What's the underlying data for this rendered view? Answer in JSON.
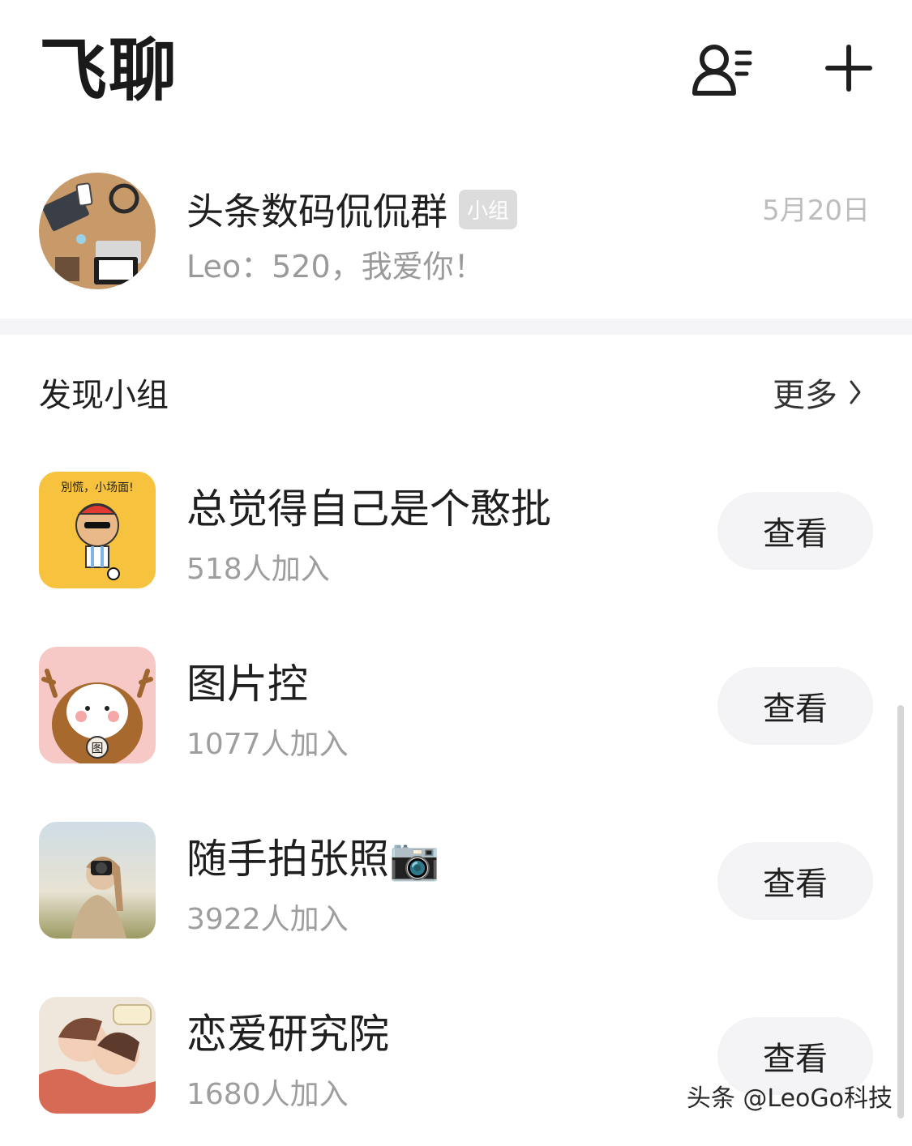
{
  "header": {
    "title": "飞聊"
  },
  "chat": {
    "name": "头条数码侃侃群",
    "tag": "小组",
    "date": "5月20日",
    "preview": "Leo：520，我爱你！"
  },
  "discover": {
    "title": "发现小组",
    "more_label": "更多"
  },
  "groups": [
    {
      "name": "总觉得自己是个憨批",
      "count": "518人加入",
      "button": "查看"
    },
    {
      "name": "图片控",
      "count": "1077人加入",
      "button": "查看"
    },
    {
      "name": "随手拍张照📷",
      "count": "3922人加入",
      "button": "查看"
    },
    {
      "name": "恋爱研究院",
      "count": "1680人加入",
      "button": "查看"
    }
  ],
  "watermark": "头条 @LeoGo科技",
  "colors": {
    "muted_text": "#9e9e9e",
    "button_bg": "#f4f4f6",
    "divider": "#f5f5f7"
  },
  "icons": [
    "contacts-icon",
    "plus-icon",
    "chevron-right-icon"
  ]
}
